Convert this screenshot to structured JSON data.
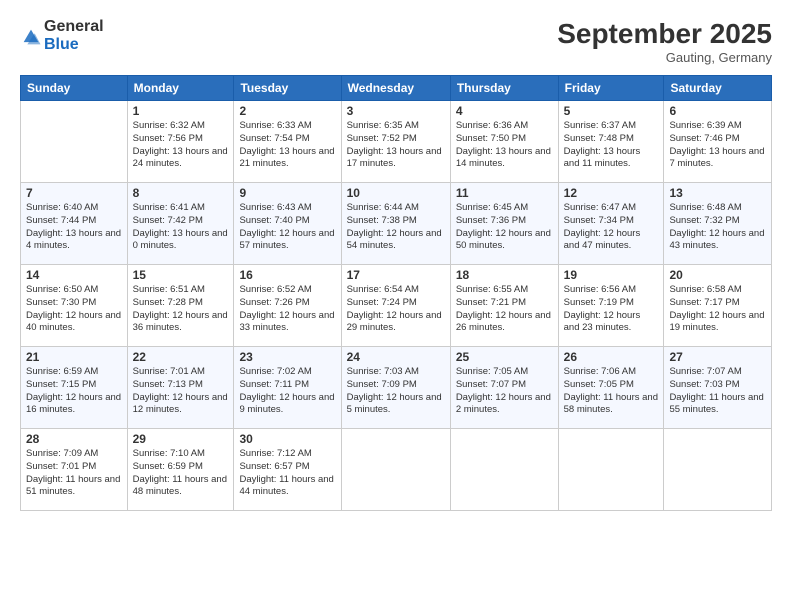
{
  "logo": {
    "general": "General",
    "blue": "Blue"
  },
  "header": {
    "month": "September 2025",
    "location": "Gauting, Germany"
  },
  "weekdays": [
    "Sunday",
    "Monday",
    "Tuesday",
    "Wednesday",
    "Thursday",
    "Friday",
    "Saturday"
  ],
  "weeks": [
    [
      {
        "day": "",
        "sunrise": "",
        "sunset": "",
        "daylight": ""
      },
      {
        "day": "1",
        "sunrise": "Sunrise: 6:32 AM",
        "sunset": "Sunset: 7:56 PM",
        "daylight": "Daylight: 13 hours and 24 minutes."
      },
      {
        "day": "2",
        "sunrise": "Sunrise: 6:33 AM",
        "sunset": "Sunset: 7:54 PM",
        "daylight": "Daylight: 13 hours and 21 minutes."
      },
      {
        "day": "3",
        "sunrise": "Sunrise: 6:35 AM",
        "sunset": "Sunset: 7:52 PM",
        "daylight": "Daylight: 13 hours and 17 minutes."
      },
      {
        "day": "4",
        "sunrise": "Sunrise: 6:36 AM",
        "sunset": "Sunset: 7:50 PM",
        "daylight": "Daylight: 13 hours and 14 minutes."
      },
      {
        "day": "5",
        "sunrise": "Sunrise: 6:37 AM",
        "sunset": "Sunset: 7:48 PM",
        "daylight": "Daylight: 13 hours and 11 minutes."
      },
      {
        "day": "6",
        "sunrise": "Sunrise: 6:39 AM",
        "sunset": "Sunset: 7:46 PM",
        "daylight": "Daylight: 13 hours and 7 minutes."
      }
    ],
    [
      {
        "day": "7",
        "sunrise": "Sunrise: 6:40 AM",
        "sunset": "Sunset: 7:44 PM",
        "daylight": "Daylight: 13 hours and 4 minutes."
      },
      {
        "day": "8",
        "sunrise": "Sunrise: 6:41 AM",
        "sunset": "Sunset: 7:42 PM",
        "daylight": "Daylight: 13 hours and 0 minutes."
      },
      {
        "day": "9",
        "sunrise": "Sunrise: 6:43 AM",
        "sunset": "Sunset: 7:40 PM",
        "daylight": "Daylight: 12 hours and 57 minutes."
      },
      {
        "day": "10",
        "sunrise": "Sunrise: 6:44 AM",
        "sunset": "Sunset: 7:38 PM",
        "daylight": "Daylight: 12 hours and 54 minutes."
      },
      {
        "day": "11",
        "sunrise": "Sunrise: 6:45 AM",
        "sunset": "Sunset: 7:36 PM",
        "daylight": "Daylight: 12 hours and 50 minutes."
      },
      {
        "day": "12",
        "sunrise": "Sunrise: 6:47 AM",
        "sunset": "Sunset: 7:34 PM",
        "daylight": "Daylight: 12 hours and 47 minutes."
      },
      {
        "day": "13",
        "sunrise": "Sunrise: 6:48 AM",
        "sunset": "Sunset: 7:32 PM",
        "daylight": "Daylight: 12 hours and 43 minutes."
      }
    ],
    [
      {
        "day": "14",
        "sunrise": "Sunrise: 6:50 AM",
        "sunset": "Sunset: 7:30 PM",
        "daylight": "Daylight: 12 hours and 40 minutes."
      },
      {
        "day": "15",
        "sunrise": "Sunrise: 6:51 AM",
        "sunset": "Sunset: 7:28 PM",
        "daylight": "Daylight: 12 hours and 36 minutes."
      },
      {
        "day": "16",
        "sunrise": "Sunrise: 6:52 AM",
        "sunset": "Sunset: 7:26 PM",
        "daylight": "Daylight: 12 hours and 33 minutes."
      },
      {
        "day": "17",
        "sunrise": "Sunrise: 6:54 AM",
        "sunset": "Sunset: 7:24 PM",
        "daylight": "Daylight: 12 hours and 29 minutes."
      },
      {
        "day": "18",
        "sunrise": "Sunrise: 6:55 AM",
        "sunset": "Sunset: 7:21 PM",
        "daylight": "Daylight: 12 hours and 26 minutes."
      },
      {
        "day": "19",
        "sunrise": "Sunrise: 6:56 AM",
        "sunset": "Sunset: 7:19 PM",
        "daylight": "Daylight: 12 hours and 23 minutes."
      },
      {
        "day": "20",
        "sunrise": "Sunrise: 6:58 AM",
        "sunset": "Sunset: 7:17 PM",
        "daylight": "Daylight: 12 hours and 19 minutes."
      }
    ],
    [
      {
        "day": "21",
        "sunrise": "Sunrise: 6:59 AM",
        "sunset": "Sunset: 7:15 PM",
        "daylight": "Daylight: 12 hours and 16 minutes."
      },
      {
        "day": "22",
        "sunrise": "Sunrise: 7:01 AM",
        "sunset": "Sunset: 7:13 PM",
        "daylight": "Daylight: 12 hours and 12 minutes."
      },
      {
        "day": "23",
        "sunrise": "Sunrise: 7:02 AM",
        "sunset": "Sunset: 7:11 PM",
        "daylight": "Daylight: 12 hours and 9 minutes."
      },
      {
        "day": "24",
        "sunrise": "Sunrise: 7:03 AM",
        "sunset": "Sunset: 7:09 PM",
        "daylight": "Daylight: 12 hours and 5 minutes."
      },
      {
        "day": "25",
        "sunrise": "Sunrise: 7:05 AM",
        "sunset": "Sunset: 7:07 PM",
        "daylight": "Daylight: 12 hours and 2 minutes."
      },
      {
        "day": "26",
        "sunrise": "Sunrise: 7:06 AM",
        "sunset": "Sunset: 7:05 PM",
        "daylight": "Daylight: 11 hours and 58 minutes."
      },
      {
        "day": "27",
        "sunrise": "Sunrise: 7:07 AM",
        "sunset": "Sunset: 7:03 PM",
        "daylight": "Daylight: 11 hours and 55 minutes."
      }
    ],
    [
      {
        "day": "28",
        "sunrise": "Sunrise: 7:09 AM",
        "sunset": "Sunset: 7:01 PM",
        "daylight": "Daylight: 11 hours and 51 minutes."
      },
      {
        "day": "29",
        "sunrise": "Sunrise: 7:10 AM",
        "sunset": "Sunset: 6:59 PM",
        "daylight": "Daylight: 11 hours and 48 minutes."
      },
      {
        "day": "30",
        "sunrise": "Sunrise: 7:12 AM",
        "sunset": "Sunset: 6:57 PM",
        "daylight": "Daylight: 11 hours and 44 minutes."
      },
      {
        "day": "",
        "sunrise": "",
        "sunset": "",
        "daylight": ""
      },
      {
        "day": "",
        "sunrise": "",
        "sunset": "",
        "daylight": ""
      },
      {
        "day": "",
        "sunrise": "",
        "sunset": "",
        "daylight": ""
      },
      {
        "day": "",
        "sunrise": "",
        "sunset": "",
        "daylight": ""
      }
    ]
  ]
}
